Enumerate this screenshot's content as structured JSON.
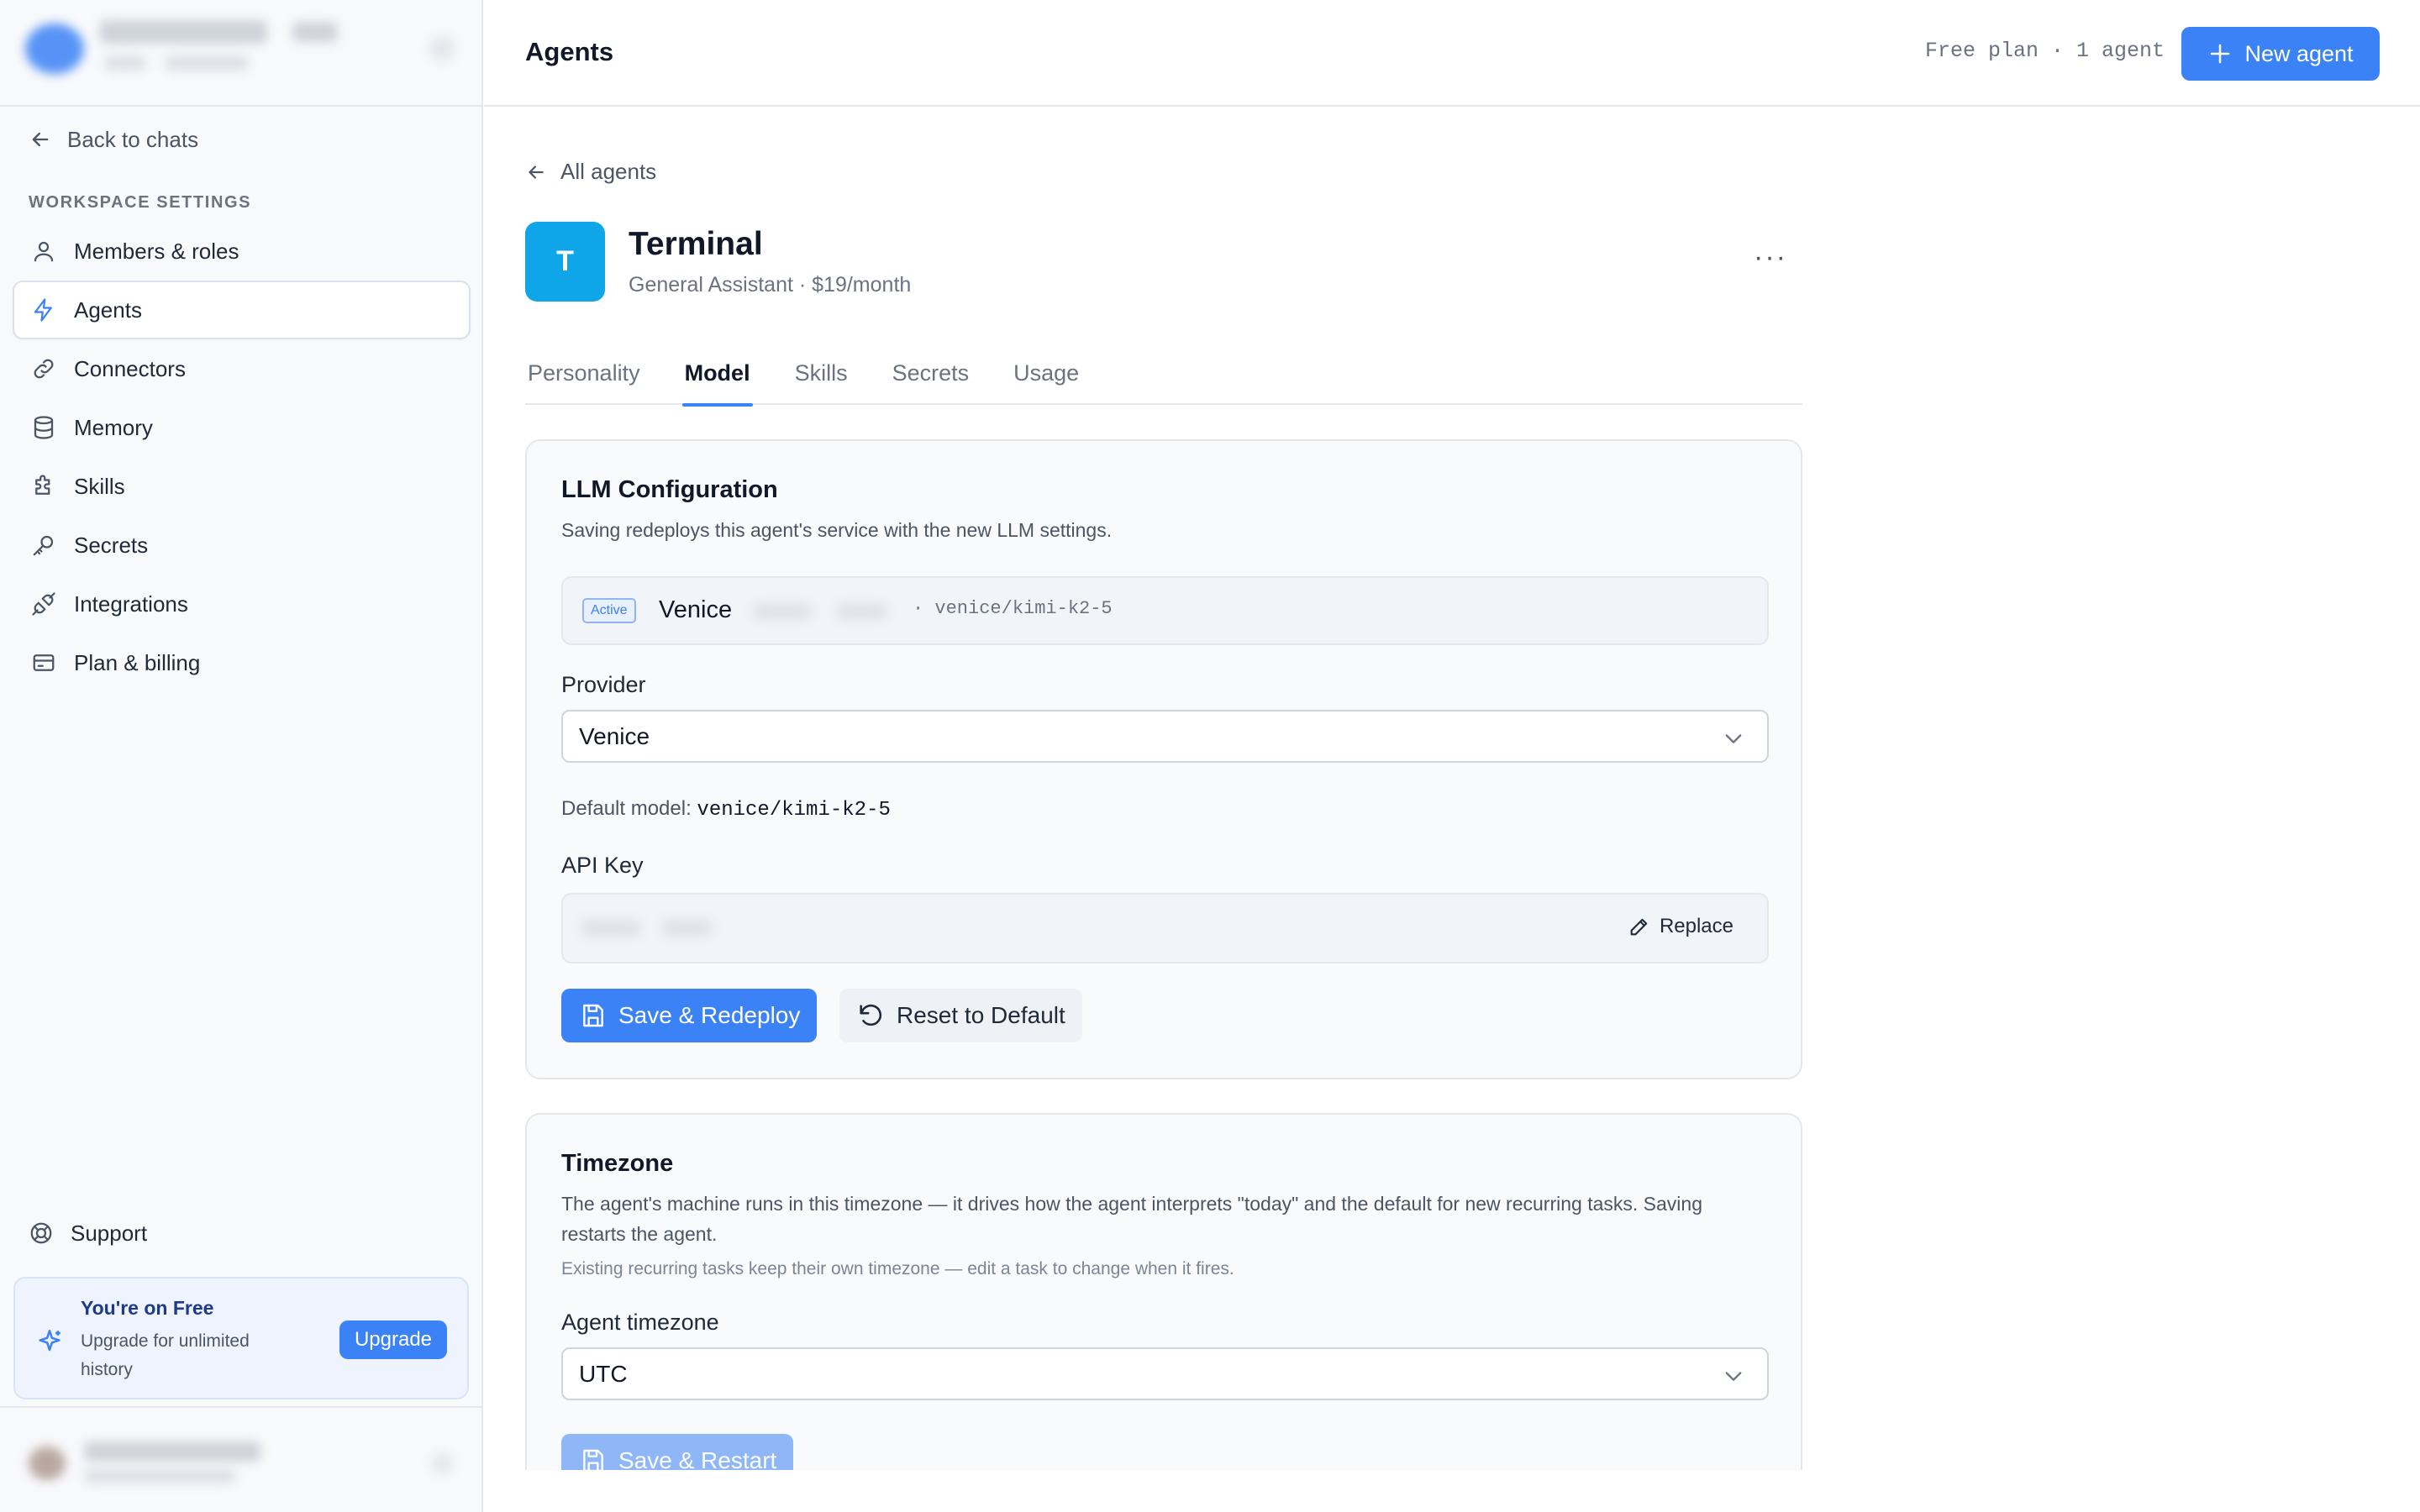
{
  "sidebar": {
    "back_label": "Back to chats",
    "section_label": "WORKSPACE SETTINGS",
    "items": [
      {
        "label": "Members & roles",
        "icon": "user-icon"
      },
      {
        "label": "Agents",
        "icon": "bolt-icon",
        "active": true
      },
      {
        "label": "Connectors",
        "icon": "link-icon"
      },
      {
        "label": "Memory",
        "icon": "database-icon"
      },
      {
        "label": "Skills",
        "icon": "puzzle-icon"
      },
      {
        "label": "Secrets",
        "icon": "key-icon"
      },
      {
        "label": "Integrations",
        "icon": "plug-icon"
      },
      {
        "label": "Plan & billing",
        "icon": "credit-card-icon"
      }
    ],
    "support_label": "Support",
    "upgrade": {
      "title": "You're on Free",
      "subtitle": "Upgrade for unlimited history",
      "button": "Upgrade"
    }
  },
  "header": {
    "title": "Agents",
    "plan_text": "Free plan · 1 agent",
    "new_agent_label": "New agent"
  },
  "agent": {
    "back_label": "All agents",
    "initial": "T",
    "name": "Terminal",
    "subtitle": "General Assistant · $19/month",
    "more_label": "···"
  },
  "tabs": [
    {
      "label": "Personality"
    },
    {
      "label": "Model",
      "active": true
    },
    {
      "label": "Skills"
    },
    {
      "label": "Secrets"
    },
    {
      "label": "Usage"
    }
  ],
  "llm": {
    "title": "LLM Configuration",
    "description": "Saving redeploys this agent's service with the new LLM settings.",
    "active_badge": "Active",
    "active_provider": "Venice",
    "active_model": "·   venice/kimi-k2-5",
    "provider_label": "Provider",
    "provider_value": "Venice",
    "default_model_prefix": "Default model:",
    "default_model_value": "venice/kimi-k2-5",
    "api_key_label": "API Key",
    "replace_label": "Replace",
    "save_label": "Save & Redeploy",
    "reset_label": "Reset to Default"
  },
  "timezone": {
    "title": "Timezone",
    "description": "The agent's machine runs in this timezone — it drives how the agent interprets \"today\" and the default for new recurring tasks. Saving restarts the agent.",
    "note": "Existing recurring tasks keep their own timezone — edit a task to change when it fires.",
    "field_label": "Agent timezone",
    "value": "UTC",
    "save_label": "Save & Restart"
  },
  "colors": {
    "accent": "#3b82f6",
    "agent_avatar": "#0ea5e9"
  }
}
